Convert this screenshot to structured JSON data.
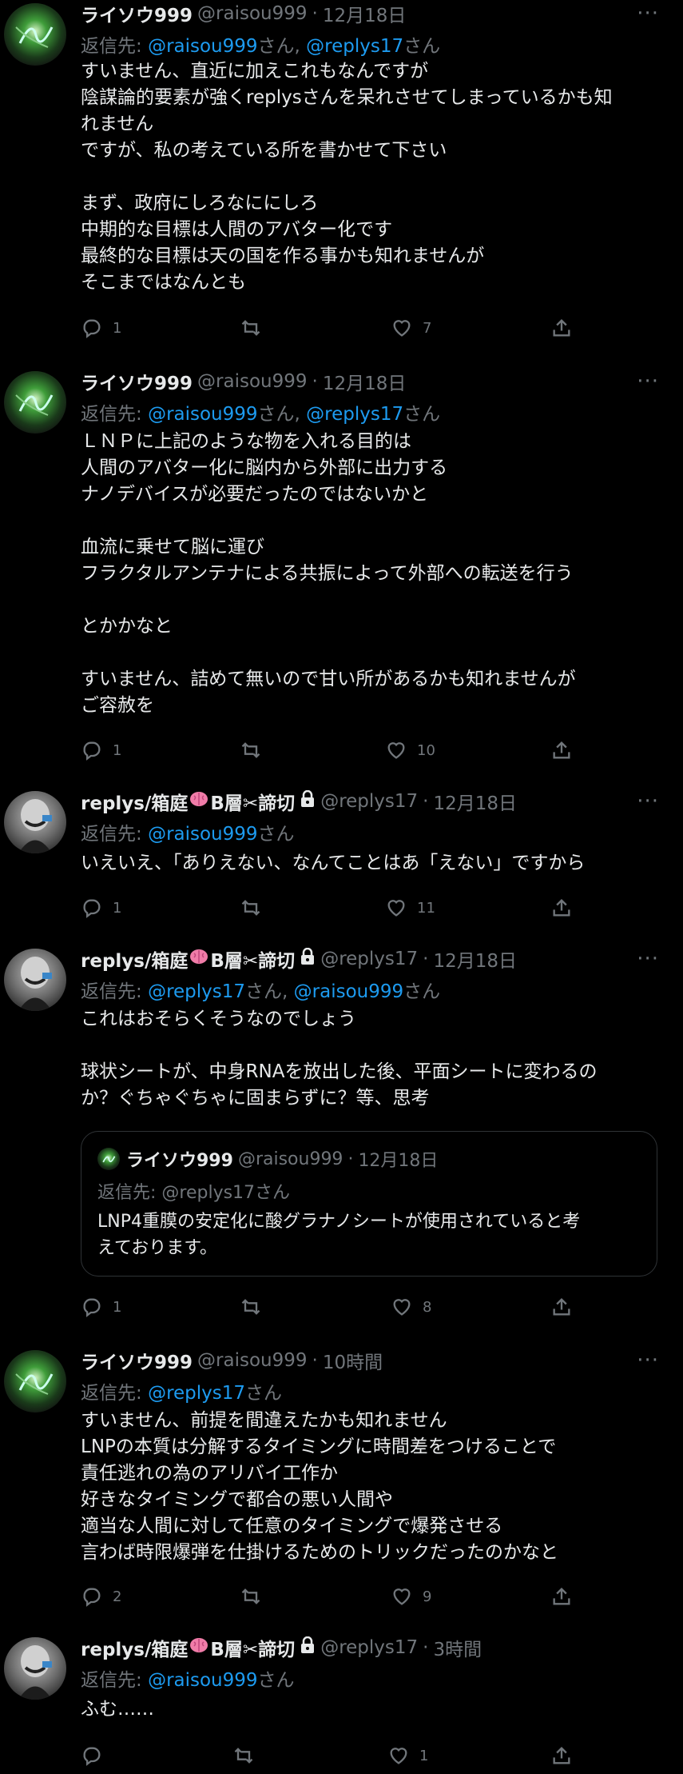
{
  "user_raisou": {
    "name": "ライソウ999",
    "handle": "@raisou999"
  },
  "user_replys": {
    "name": "replys/箱庭",
    "name_tail": "B層✂諦切",
    "handle": "@replys17"
  },
  "labels": {
    "reply_prefix": "返信先: ",
    "san": "さん",
    "comma": ", ",
    "dot": "·",
    "more": "···"
  },
  "tweets": [
    {
      "time": "12月18日",
      "reply_to": [
        "@raisou999",
        "@replys17"
      ],
      "lines": [
        "すいません、直近に加えこれもなんですが",
        "陰謀論的要素が強くreplysさんを呆れさせてしまっているかも知",
        "れません",
        "ですが、私の考えている所を書かせて下さい",
        "",
        "まず、政府にしろなににしろ",
        "中期的な目標は人間のアバター化です",
        "最終的な目標は天の国を作る事かも知れませんが",
        "そこまではなんとも"
      ],
      "replies": "1",
      "retweets": "",
      "likes": "7"
    },
    {
      "time": "12月18日",
      "reply_to": [
        "@raisou999",
        "@replys17"
      ],
      "lines": [
        "ＬＮＰに上記のような物を入れる目的は",
        "人間のアバター化に脳内から外部に出力する",
        "ナノデバイスが必要だったのではないかと",
        "",
        "血流に乗せて脳に運び",
        "フラクタルアンテナによる共振によって外部への転送を行う",
        "",
        "とかかなと",
        "",
        "すいません、詰めて無いので甘い所があるかも知れませんが",
        "ご容赦を"
      ],
      "replies": "1",
      "retweets": "",
      "likes": "10"
    },
    {
      "time": "12月18日",
      "reply_to": [
        "@raisou999"
      ],
      "lines": [
        "いえいえ、「ありえない、なんてことはあ「えない」ですから"
      ],
      "replies": "1",
      "retweets": "",
      "likes": "11"
    },
    {
      "time": "12月18日",
      "reply_to": [
        "@replys17",
        "@raisou999"
      ],
      "lines": [
        "これはおそらくそうなのでしょう",
        "",
        "球状シートが、中身RNAを放出した後、平面シートに変わるの",
        "か？ぐちゃぐちゃに固まらずに？等、思考"
      ],
      "quote": {
        "name": "ライソウ999",
        "handle": "@raisou999",
        "time": "12月18日",
        "reply": "返信先: @replys17さん",
        "lines": [
          "LNP4重膜の安定化に酸グラナノシートが使用されていると考",
          "えております。"
        ]
      },
      "replies": "1",
      "retweets": "",
      "likes": "8"
    },
    {
      "time": "10時間",
      "reply_to": [
        "@replys17"
      ],
      "lines": [
        "すいません、前提を間違えたかも知れません",
        "LNPの本質は分解するタイミングに時間差をつけることで",
        "責任逃れの為のアリバイ工作か",
        "好きなタイミングで都合の悪い人間や",
        "適当な人間に対して任意のタイミングで爆発させる",
        "言わば時限爆弾を仕掛けるためのトリックだったのかなと"
      ],
      "replies": "2",
      "retweets": "",
      "likes": "9"
    },
    {
      "time": "3時間",
      "reply_to": [
        "@raisou999"
      ],
      "lines": [
        "ふむ……"
      ],
      "replies": "",
      "retweets": "",
      "likes": "1"
    }
  ],
  "colors": {
    "bg": "#000000",
    "text": "#e7e9ea",
    "muted": "#71767b",
    "link": "#1d9bf0",
    "border": "#2f3336"
  },
  "icons": {
    "reply": "reply-icon",
    "retweet": "retweet-icon",
    "like": "heart-icon",
    "share": "share-icon",
    "lock": "lock-icon",
    "brain": "brain-icon"
  }
}
